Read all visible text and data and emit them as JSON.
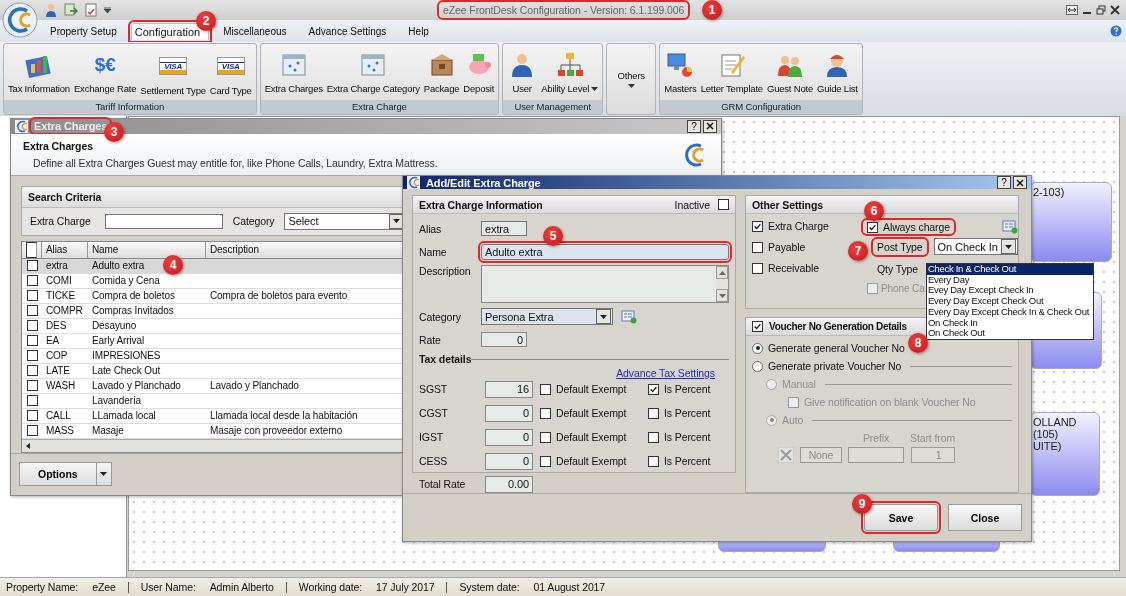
{
  "app": {
    "title": "eZee FrontDesk Configuration - Version: 6.1.199.006",
    "title_highlighted": true
  },
  "menu_tabs": [
    {
      "label": "Property Setup",
      "selected": false,
      "highlighted": false
    },
    {
      "label": "Configuration",
      "selected": true,
      "highlighted": true
    },
    {
      "label": "Miscellaneous",
      "selected": false,
      "highlighted": false
    },
    {
      "label": "Advance Settings",
      "selected": false,
      "highlighted": false
    },
    {
      "label": "Help",
      "selected": false,
      "highlighted": false
    }
  ],
  "ribbon_groups": [
    {
      "label": "Tariff Information",
      "items": [
        {
          "label": "Tax Information",
          "has_menu": false
        },
        {
          "label": "Exchange Rate",
          "glyph": "$€",
          "has_menu": false
        },
        {
          "label": "Settlement Type",
          "glyph": "VISA",
          "has_menu": false
        },
        {
          "label": "Card Type",
          "glyph": "VISA",
          "has_menu": false
        }
      ]
    },
    {
      "label": "Extra Charge",
      "items": [
        {
          "label": "Extra Charges",
          "has_menu": false
        },
        {
          "label": "Extra Charge Category",
          "has_menu": false
        },
        {
          "label": "Package",
          "has_menu": false
        },
        {
          "label": "Deposit",
          "has_menu": false
        }
      ]
    },
    {
      "label": "User Management",
      "items": [
        {
          "label": "User",
          "has_menu": false
        },
        {
          "label": "Ability Level",
          "has_menu": true
        }
      ]
    },
    {
      "kind": "single",
      "items": [
        {
          "label": "Others",
          "has_menu": true
        }
      ]
    },
    {
      "label": "GRM Configuration",
      "items": [
        {
          "label": "Masters",
          "has_menu": false
        },
        {
          "label": "Letter Template",
          "has_menu": false
        },
        {
          "label": "Guest Note",
          "has_menu": false
        },
        {
          "label": "Guide List",
          "has_menu": false
        }
      ]
    }
  ],
  "room_cards": [
    {
      "kind": "room",
      "lines": [
        "2-103)"
      ]
    },
    {
      "kind": "room"
    },
    {
      "kind": "room",
      "lines": [
        "OLLAND (105)",
        "UITE)"
      ]
    },
    {
      "kind": "room"
    },
    {
      "kind": "room"
    }
  ],
  "extra_charges_window": {
    "title": "Extra Charges",
    "title_highlighted": true,
    "help_button": "?",
    "heading": "Extra Charges",
    "description": "Define all Extra Charges Guest may entitle for, like Phone Calls, Laundry, Extra Mattress.",
    "search": {
      "title": "Search Criteria",
      "extra_charge_label": "Extra Charge",
      "category_label": "Category",
      "category_value": "Select"
    },
    "table": {
      "columns": [
        "Alias",
        "Name",
        "Description"
      ],
      "header_checked": false,
      "rows": [
        {
          "alias": "extra",
          "name": "Adulto extra",
          "selected": true,
          "checked": false
        },
        {
          "alias": "COMI",
          "name": "Comida y Cena",
          "selected": false,
          "checked": false
        },
        {
          "alias": "TICKE",
          "name": "Compra de boletos",
          "description": "Compra de boletos para evento",
          "selected": false,
          "checked": false
        },
        {
          "alias": "COMPR",
          "name": "Compras Invitados",
          "selected": false,
          "checked": false
        },
        {
          "alias": "DES",
          "name": "Desayuno",
          "selected": false,
          "checked": false
        },
        {
          "alias": "EA",
          "name": "Early Arrival",
          "selected": false,
          "checked": false
        },
        {
          "alias": "COP",
          "name": "IMPRESIONES",
          "selected": false,
          "checked": false
        },
        {
          "alias": "LATE",
          "name": "Late Check Out",
          "selected": false,
          "checked": false
        },
        {
          "alias": "WASH",
          "name": "Lavado y Planchado",
          "description": "Lavado y Planchado",
          "selected": false,
          "checked": false
        },
        {
          "name": "Lavandería",
          "selected": false,
          "checked": false
        },
        {
          "alias": "CALL",
          "name": "LLamada local",
          "description": "Llamada local desde la habitación",
          "selected": false,
          "checked": false
        },
        {
          "alias": "MASS",
          "name": "Masaje",
          "description": "Masaje con proveedor externo",
          "selected": false,
          "checked": false
        }
      ]
    },
    "options_button": "Options"
  },
  "dialog": {
    "title": "Add/Edit Extra Charge",
    "help_button": "?",
    "info": {
      "title": "Extra Charge Information",
      "inactive_label": "Inactive",
      "inactive": false,
      "alias_label": "Alias",
      "alias": "extra",
      "name_label": "Name",
      "name": "Adulto extra",
      "name_highlighted": true,
      "description_label": "Description",
      "category_label": "Category",
      "category": "Persona Extra",
      "rate_label": "Rate",
      "rate": "0"
    },
    "tax": {
      "title": "Tax details",
      "link": "Advance Tax Settings",
      "rows": [
        {
          "label": "SGST",
          "value": "16",
          "exempt_label": "Default Exempt",
          "exempt": false,
          "percent_label": "Is Percent",
          "percent": true
        },
        {
          "label": "CGST",
          "value": "0",
          "exempt_label": "Default Exempt",
          "exempt": false,
          "percent_label": "Is Percent",
          "percent": false
        },
        {
          "label": "IGST",
          "value": "0",
          "exempt_label": "Default Exempt",
          "exempt": false,
          "percent_label": "Is Percent",
          "percent": false
        },
        {
          "label": "CESS",
          "value": "0",
          "exempt_label": "Default Exempt",
          "exempt": false,
          "percent_label": "Is Percent",
          "percent": false
        }
      ],
      "total_label": "Total Rate",
      "total": "0.00"
    },
    "other": {
      "title": "Other Settings",
      "checks": [
        {
          "label": "Extra Charge",
          "checked": true
        },
        {
          "label": "Payable",
          "checked": false
        },
        {
          "label": "Receivable",
          "checked": false
        }
      ],
      "always_charge": {
        "label": "Always charge",
        "checked": true,
        "highlighted": true
      },
      "post_type": {
        "label": "Post Type",
        "value": "On Check In",
        "highlighted": true
      },
      "qty_type_label": "Qty Type",
      "phone_call": {
        "label": "Phone Ca",
        "checked": false,
        "disabled": true
      }
    },
    "voucher": {
      "title": "Voucher No Generation Details",
      "checked": true,
      "options": [
        {
          "label": "Generate general Voucher No",
          "selected": true
        },
        {
          "label": "Generate private Voucher No",
          "selected": false
        }
      ],
      "manual": {
        "label": "Manual",
        "selected": false,
        "disabled": true
      },
      "notify": {
        "label": "Give notification on blank Voucher No",
        "checked": false,
        "disabled": true
      },
      "auto": {
        "label": "Auto",
        "selected": true,
        "disabled": true
      },
      "none_button": "None",
      "prefix_label": "Prefix",
      "start_label": "Start from",
      "start_value": "1"
    },
    "buttons": [
      {
        "label": "Save",
        "highlighted": true
      },
      {
        "label": "Close",
        "highlighted": false
      }
    ]
  },
  "dropdown": {
    "options": [
      {
        "label": "Check In & Check Out",
        "selected": true
      },
      {
        "label": "Every Day",
        "selected": false
      },
      {
        "label": "Evey Day Except Check In",
        "selected": false
      },
      {
        "label": "Every Day Except Check Out",
        "selected": false
      },
      {
        "label": "Every Day Except Check In & Check Out",
        "selected": false
      },
      {
        "label": "On Check In",
        "selected": false
      },
      {
        "label": "On Check Out",
        "selected": false
      }
    ]
  },
  "annotations": [
    {
      "number": "1"
    },
    {
      "number": "2"
    },
    {
      "number": "3"
    },
    {
      "number": "4"
    },
    {
      "number": "5"
    },
    {
      "number": "6"
    },
    {
      "number": "7"
    },
    {
      "number": "8"
    },
    {
      "number": "9"
    }
  ],
  "status_bar": [
    {
      "label": "Property Name:",
      "value": "eZee"
    },
    {
      "label": "User Name:",
      "value": "Admin Alberto"
    },
    {
      "label": "Working date:",
      "value": "17 July 2017"
    },
    {
      "label": "System date:",
      "value": "01 August 2017"
    }
  ]
}
